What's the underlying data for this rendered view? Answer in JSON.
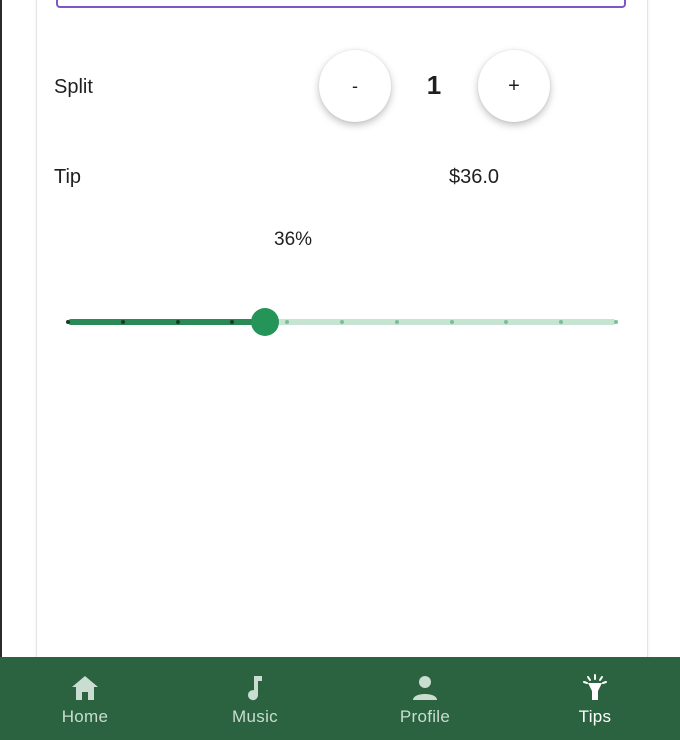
{
  "split": {
    "label": "Split",
    "decrement_label": "-",
    "count": "1",
    "increment_label": "+"
  },
  "tip": {
    "label": "Tip",
    "amount": "$36.0",
    "percent_label": "36%",
    "slider": {
      "value_percent": 36,
      "steps": 11,
      "step_percent": 10,
      "active_color": "#2a8a55",
      "inactive_color": "#c5e4d2",
      "thumb_color": "#249458"
    }
  },
  "accent_input_border": "#7e57c2",
  "bottom_nav": {
    "background": "#2b6340",
    "items": [
      {
        "label": "Home",
        "icon": "home-icon",
        "active": false
      },
      {
        "label": "Music",
        "icon": "music-note-icon",
        "active": false
      },
      {
        "label": "Profile",
        "icon": "person-icon",
        "active": false
      },
      {
        "label": "Tips",
        "icon": "flashlight-icon",
        "active": true
      }
    ]
  }
}
